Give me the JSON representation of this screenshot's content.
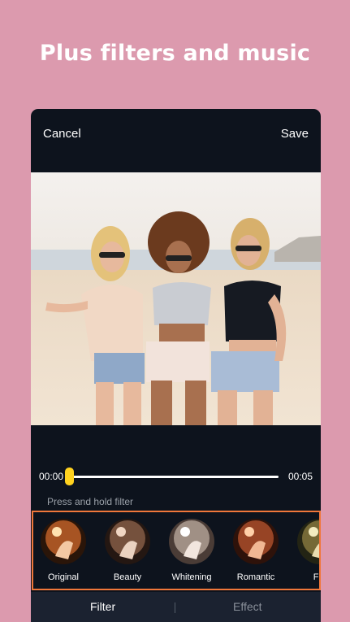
{
  "headline": "Plus filters and music",
  "topbar": {
    "cancel_label": "Cancel",
    "save_label": "Save"
  },
  "timeline": {
    "start_time": "00:00",
    "end_time": "00:05",
    "progress": 0.0
  },
  "hint": "Press and hold filter",
  "filters": [
    {
      "label": "Original",
      "tint": "#c7642a"
    },
    {
      "label": "Beauty",
      "tint": "#8a6048"
    },
    {
      "label": "Whitening",
      "tint": "#b5a59a"
    },
    {
      "label": "Romantic",
      "tint": "#b2512c"
    },
    {
      "label": "Fre",
      "tint": "#8a7a3e"
    }
  ],
  "tabs": {
    "filter_label": "Filter",
    "effect_label": "Effect",
    "active": "Filter"
  },
  "colors": {
    "background": "#dc9aae",
    "accent": "#f0773a",
    "knob": "#ffd21f"
  }
}
